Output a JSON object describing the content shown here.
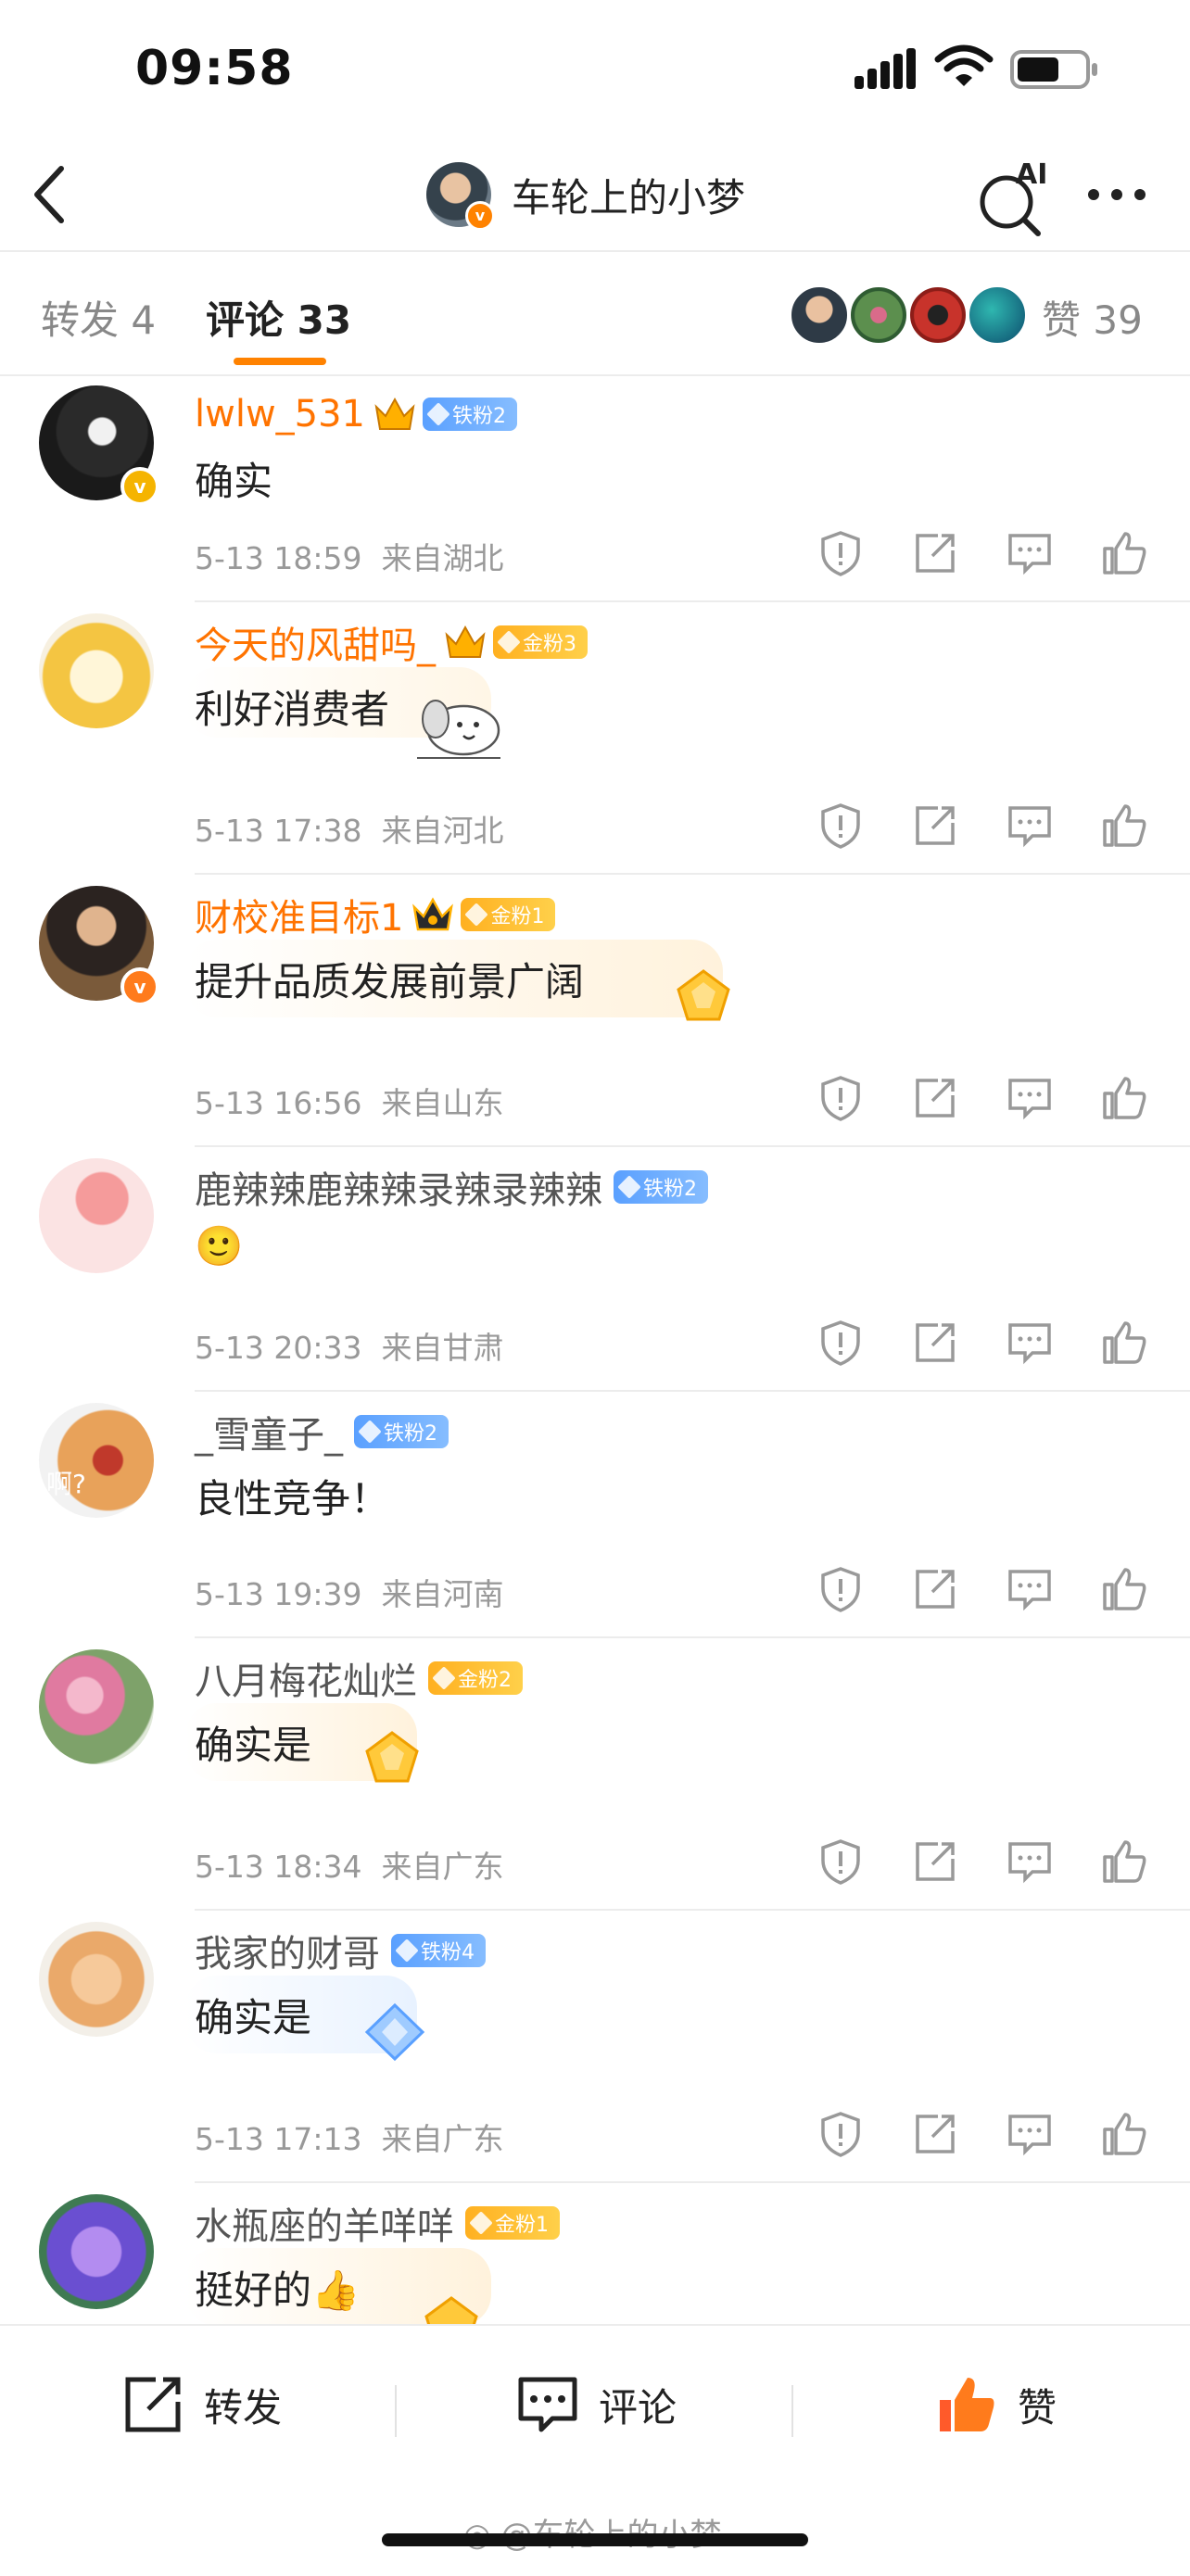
{
  "status": {
    "time": "09:58"
  },
  "nav": {
    "title": "车轮上的小梦",
    "ai_label": "AI"
  },
  "tabs": {
    "repost_label": "转发",
    "repost_count": "4",
    "comment_label": "评论",
    "comment_count": "33",
    "like_label": "赞",
    "like_count": "39"
  },
  "comments": [
    {
      "username": "lwlw_531",
      "badge": "铁粉2",
      "text": "确实",
      "time": "5-13 18:59",
      "location": "来自湖北"
    },
    {
      "username": "今天的风甜吗_",
      "badge": "金粉3",
      "text": "利好消费者",
      "time": "5-13 17:38",
      "location": "来自河北"
    },
    {
      "username": "财校准目标1",
      "badge": "金粉1",
      "text": "提升品质发展前景广阔",
      "time": "5-13 16:56",
      "location": "来自山东"
    },
    {
      "username": "鹿辣辣鹿辣辣录辣录辣辣",
      "badge": "铁粉2",
      "text": "🙂",
      "time": "5-13 20:33",
      "location": "来自甘肃"
    },
    {
      "username": "_雪童子_",
      "badge": "铁粉2",
      "text": "良性竞争！",
      "time": "5-13 19:39",
      "location": "来自河南"
    },
    {
      "username": "八月梅花灿烂",
      "badge": "金粉2",
      "text": "确实是",
      "time": "5-13 18:34",
      "location": "来自广东"
    },
    {
      "username": "我家的财哥",
      "badge": "铁粉4",
      "text": "确实是",
      "time": "5-13 17:13",
      "location": "来自广东"
    },
    {
      "username": "水瓶座的羊咩咩",
      "badge": "金粉1",
      "text": "挺好的👍",
      "time": "",
      "location": ""
    }
  ],
  "avatar_texts": {
    "c4": "啊?"
  },
  "bottom_bar": {
    "repost": "转发",
    "comment": "评论",
    "like": "赞"
  },
  "watermark": "@车轮上的小梦",
  "colors": {
    "accent": "#ff8200",
    "vip_name": "#ff7300",
    "iron_badge": "#5aa0ff",
    "gold_badge": "#ffb020",
    "meta": "#999999"
  }
}
